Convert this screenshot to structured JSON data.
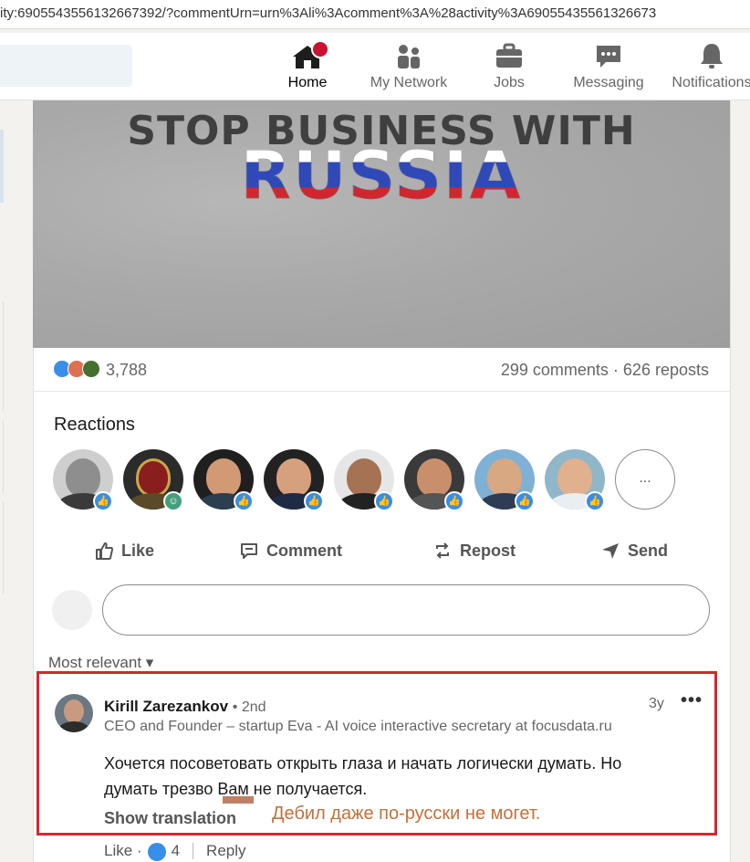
{
  "browser": {
    "url_text": "ity:6905543556132667392/?commentUrn=urn%3Ali%3Acomment%3A%28activity%3A69055435561326673"
  },
  "nav": {
    "items": [
      {
        "label": "Home",
        "icon": "home-icon",
        "active": true
      },
      {
        "label": "My Network",
        "icon": "network-icon"
      },
      {
        "label": "Jobs",
        "icon": "briefcase-icon"
      },
      {
        "label": "Messaging",
        "icon": "messaging-icon"
      },
      {
        "label": "Notifications",
        "icon": "bell-icon"
      }
    ]
  },
  "post": {
    "banner_line1": "STOP BUSINESS WITH",
    "banner_line2": "RUSSIA",
    "reaction_count": "3,788",
    "stats": "299 comments · 626 reposts"
  },
  "reactions": {
    "title": "Reactions",
    "more_label": "..."
  },
  "actions": {
    "like": "Like",
    "comment": "Comment",
    "repost": "Repost",
    "send": "Send"
  },
  "comments": {
    "sort_label": "Most relevant",
    "item": {
      "author": "Kirill Zarezankov",
      "degree": "• 2nd",
      "time": "3y",
      "menu": "•••",
      "headline": "CEO and Founder – startup Eva - AI voice interactive secretary at focusdata.ru",
      "text_line1": "Хочется посоветовать открыть глаза и начать логически думать. Но",
      "text_line2": "думать трезво Вам не получается.",
      "translate": "Show translation",
      "like_label": "Like ·",
      "like_count": "4",
      "reply_label": "Reply"
    },
    "annotation": "Дебил даже по-русски не могет."
  },
  "colors": {
    "accent": "#0a66c2",
    "badge_red": "#cb112d",
    "highlight_red": "#d6262e",
    "annotation": "#c4703a"
  }
}
